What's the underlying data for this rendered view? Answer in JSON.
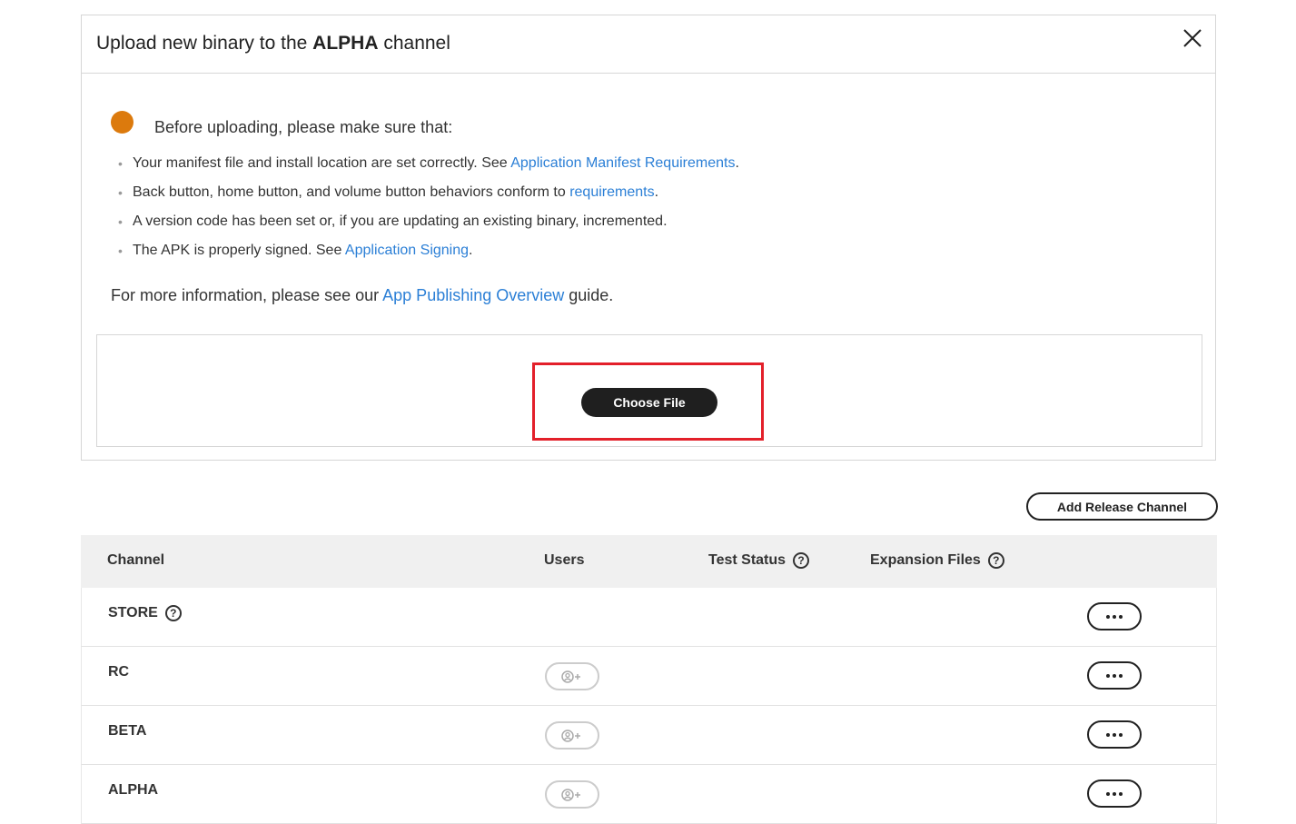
{
  "dialog": {
    "title_prefix": "Upload new binary to the ",
    "title_channel": "ALPHA",
    "title_suffix": " channel",
    "intro": "Before uploading, please make sure that:",
    "bullets": [
      {
        "text": "Your manifest file and install location are set correctly. See ",
        "link": "Application Manifest Requirements",
        "after": "."
      },
      {
        "text": "Back button, home button, and volume button behaviors conform to ",
        "link": "requirements",
        "after": "."
      },
      {
        "text": "A version code has been set or, if you are updating an existing binary, incremented.",
        "link": "",
        "after": ""
      },
      {
        "text": "The APK is properly signed. See ",
        "link": "Application Signing",
        "after": "."
      }
    ],
    "more_info_prefix": "For more information, please see our ",
    "more_info_link": "App Publishing Overview",
    "more_info_suffix": " guide.",
    "choose_file_label": "Choose File",
    "warning_color": "#dc7a0d",
    "link_color": "#2b7fd6"
  },
  "add_channel_label": "Add Release Channel",
  "table": {
    "headers": {
      "channel": "Channel",
      "users": "Users",
      "test_status": "Test Status",
      "expansion_files": "Expansion Files"
    },
    "rows": [
      {
        "name": "STORE",
        "has_help": true,
        "has_users": false
      },
      {
        "name": "RC",
        "has_help": false,
        "has_users": true
      },
      {
        "name": "BETA",
        "has_help": false,
        "has_users": true
      },
      {
        "name": "ALPHA",
        "has_help": false,
        "has_users": true
      }
    ]
  }
}
